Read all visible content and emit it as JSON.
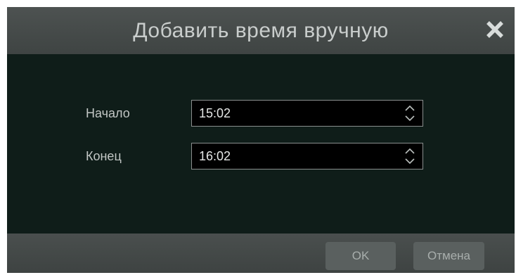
{
  "dialog": {
    "title": "Добавить время вручную",
    "close_icon": "close-icon"
  },
  "form": {
    "start": {
      "label": "Начало",
      "value": "15:02"
    },
    "end": {
      "label": "Конец",
      "value": "16:02"
    }
  },
  "footer": {
    "ok_label": "OK",
    "cancel_label": "Отмена"
  },
  "colors": {
    "dialog_background": "#0f1d19",
    "titlebar_background": "#4a4f4e",
    "field_background": "#000000",
    "field_border": "#8a8f8e",
    "button_background": "#5a605f"
  }
}
